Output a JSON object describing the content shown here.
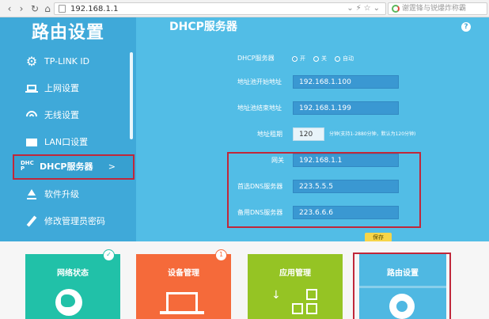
{
  "browser": {
    "url": "192.168.1.1",
    "search_placeholder": "谢霆锋与锐爆炸称霸"
  },
  "sidebar": {
    "title": "路由设置",
    "items": [
      {
        "label": "TP-LINK ID",
        "icon": "gear-icon"
      },
      {
        "label": "上网设置",
        "icon": "laptop-icon"
      },
      {
        "label": "无线设置",
        "icon": "wifi-icon"
      },
      {
        "label": "LAN口设置",
        "icon": "lan-icon"
      },
      {
        "label": "DHCP服务器",
        "icon": "dhcp-icon",
        "active": true
      },
      {
        "label": "软件升级",
        "icon": "upload-icon"
      },
      {
        "label": "修改管理员密码",
        "icon": "pencil-icon"
      }
    ],
    "dhcp_icon_text": "DHC P",
    "active_arrow": ">"
  },
  "main": {
    "title": "DHCP服务器",
    "help": "?",
    "dhcp_server_label": "DHCP服务器",
    "radio_on": "开",
    "radio_off": "关",
    "radio_auto": "自动",
    "start_label": "地址池开始地址",
    "start_value": "192.168.1.100",
    "end_label": "地址池结束地址",
    "end_value": "192.168.1.199",
    "lease_label": "地址租期",
    "lease_value": "120",
    "lease_hint": "分钟(支持1-2880分钟，默认为120分钟)",
    "gateway_label": "网关",
    "gateway_value": "192.168.1.1",
    "dns1_label": "首选DNS服务器",
    "dns1_value": "223.5.5.5",
    "dns2_label": "备用DNS服务器",
    "dns2_value": "223.6.6.6",
    "save_label": "保存"
  },
  "tiles": [
    {
      "label": "网络状态",
      "color": "#21c1a8"
    },
    {
      "label": "设备管理",
      "color": "#f56a3a",
      "badge": "1"
    },
    {
      "label": "应用管理",
      "color": "#95c424"
    },
    {
      "label": "路由设置",
      "color": "#4fb8e2"
    }
  ],
  "colors": {
    "sidebar": "#3fa9d9",
    "main": "#52bde6",
    "highlight": "#c0273a"
  }
}
